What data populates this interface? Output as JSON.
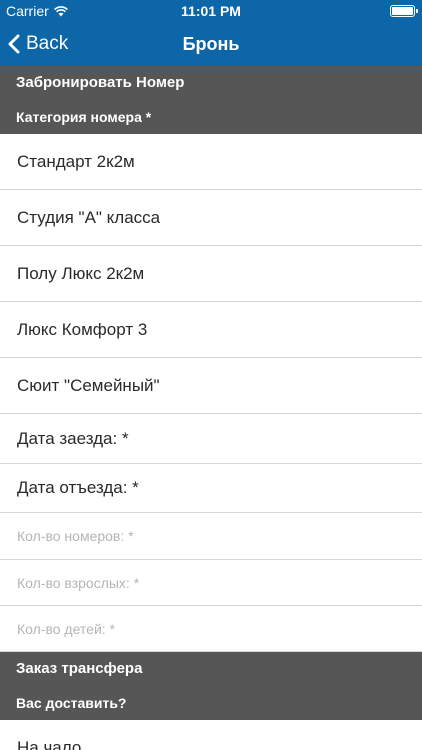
{
  "status_bar": {
    "carrier": "Carrier",
    "time": "11:01 PM",
    "wifi_icon": "wifi-icon",
    "battery_icon": "battery-icon"
  },
  "nav": {
    "back_label": "Back",
    "title": "Бронь",
    "back_icon": "chevron-left-icon"
  },
  "colors": {
    "nav_bg": "#0c66a8",
    "section_bg": "#565656",
    "placeholder": "#b5b5b8"
  },
  "booking_section": {
    "title": "Забронировать Номер",
    "subtitle": "Категория номера *"
  },
  "room_categories": [
    "Стандарт 2к2м",
    "Студия \"А\" класса",
    "Полу Люкс 2к2м",
    "Люкс Комфорт 3",
    "Сюит \"Семейный\""
  ],
  "dates": {
    "arrival": "Дата заезда: *",
    "departure": "Дата отъезда: *"
  },
  "fields": {
    "rooms_placeholder": "Кол-во номеров: *",
    "adults_placeholder": "Кол-во взрослых: *",
    "children_placeholder": "Кол-во детей: *"
  },
  "transfer_section": {
    "title": "Заказ трансфера",
    "subtitle": "Вас доставить?"
  },
  "transfer_options": [
    "На чало"
  ]
}
